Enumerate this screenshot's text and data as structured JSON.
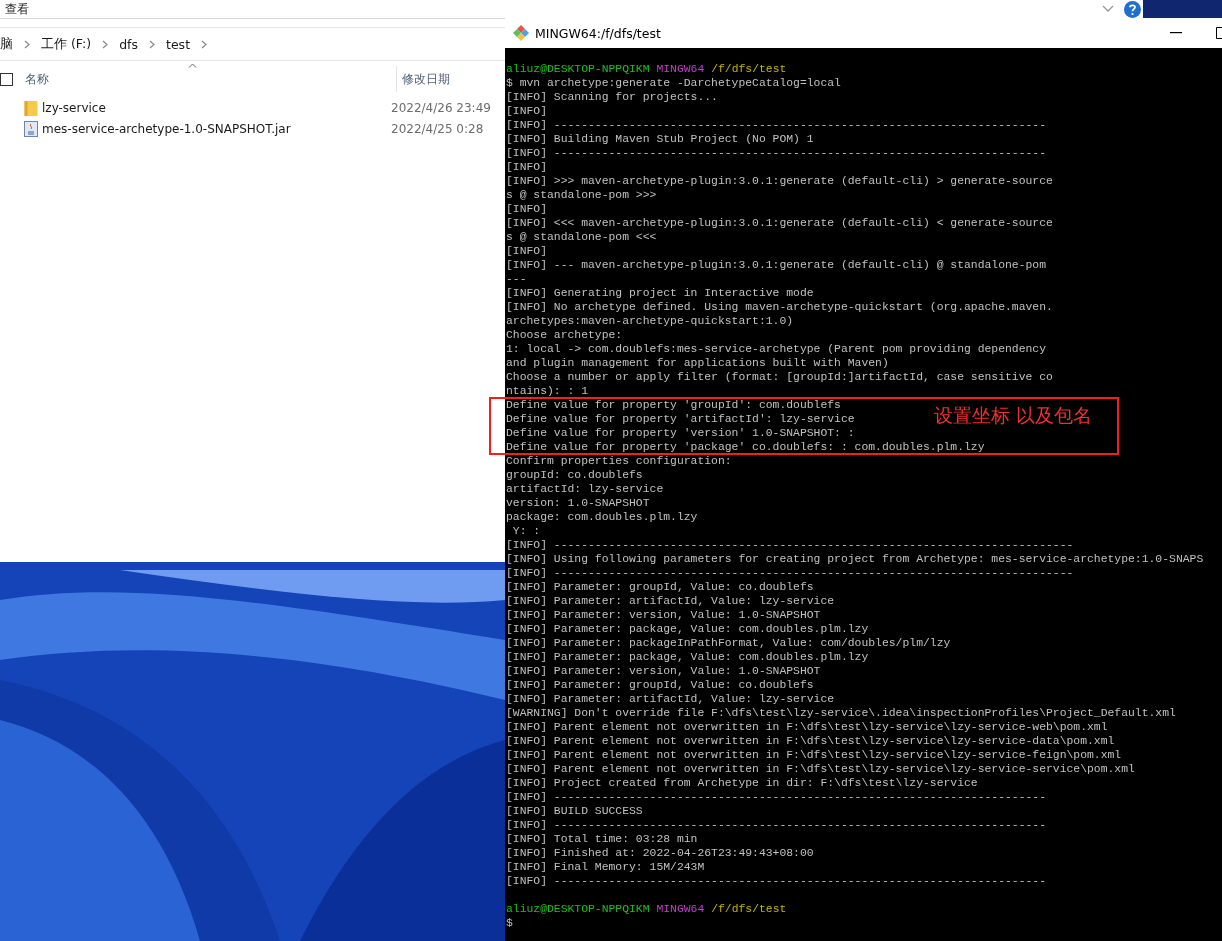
{
  "explorer": {
    "menu": "查看",
    "breadcrumb": [
      "脑",
      "工作 (F:)",
      "dfs",
      "test"
    ],
    "columns": [
      "名称",
      "修改日期"
    ],
    "select_all": {
      "checked": false
    },
    "files": [
      {
        "kind": "folder",
        "name": "lzy-service",
        "modified": "2022/4/26 23:49"
      },
      {
        "kind": "jar",
        "name": "mes-service-archetype-1.0-SNAPSHOT.jar",
        "modified": "2022/4/25 0:28"
      }
    ]
  },
  "terminal": {
    "title": "MINGW64:/f/dfs/test",
    "lines": [
      {
        "kind": "prompt",
        "user": "aliuz@DESKTOP-NPPQIKM",
        "shell": "MINGW64",
        "path": "/f/dfs/test"
      },
      {
        "kind": "text",
        "text": "$ mvn archetype:generate -DarchetypeCatalog=local"
      },
      {
        "kind": "text",
        "text": "[INFO] Scanning for projects..."
      },
      {
        "kind": "text",
        "text": "[INFO]"
      },
      {
        "kind": "text",
        "text": "[INFO] ------------------------------------------------------------------------"
      },
      {
        "kind": "text",
        "text": "[INFO] Building Maven Stub Project (No POM) 1"
      },
      {
        "kind": "text",
        "text": "[INFO] ------------------------------------------------------------------------"
      },
      {
        "kind": "text",
        "text": "[INFO]"
      },
      {
        "kind": "text",
        "text": "[INFO] >>> maven-archetype-plugin:3.0.1:generate (default-cli) > generate-source"
      },
      {
        "kind": "text",
        "text": "s @ standalone-pom >>>"
      },
      {
        "kind": "text",
        "text": "[INFO]"
      },
      {
        "kind": "text",
        "text": "[INFO] <<< maven-archetype-plugin:3.0.1:generate (default-cli) < generate-source"
      },
      {
        "kind": "text",
        "text": "s @ standalone-pom <<<"
      },
      {
        "kind": "text",
        "text": "[INFO]"
      },
      {
        "kind": "text",
        "text": "[INFO] --- maven-archetype-plugin:3.0.1:generate (default-cli) @ standalone-pom"
      },
      {
        "kind": "text",
        "text": "---"
      },
      {
        "kind": "text",
        "text": "[INFO] Generating project in Interactive mode"
      },
      {
        "kind": "text",
        "text": "[INFO] No archetype defined. Using maven-archetype-quickstart (org.apache.maven."
      },
      {
        "kind": "text",
        "text": "archetypes:maven-archetype-quickstart:1.0)"
      },
      {
        "kind": "text",
        "text": "Choose archetype:"
      },
      {
        "kind": "text",
        "text": "1: local -> com.doublefs:mes-service-archetype (Parent pom providing dependency"
      },
      {
        "kind": "text",
        "text": "and plugin management for applications built with Maven)"
      },
      {
        "kind": "text",
        "text": "Choose a number or apply filter (format: [groupId:]artifactId, case sensitive co"
      },
      {
        "kind": "text",
        "text": "ntains): : 1"
      },
      {
        "kind": "text",
        "text": "Define value for property 'groupId': com.doublefs"
      },
      {
        "kind": "text",
        "text": "Define value for property 'artifactId': lzy-service"
      },
      {
        "kind": "text",
        "text": "Define value for property 'version' 1.0-SNAPSHOT: :"
      },
      {
        "kind": "text",
        "text": "Define value for property 'package' co.doublefs: : com.doubles.plm.lzy"
      },
      {
        "kind": "text",
        "text": "Confirm properties configuration:"
      },
      {
        "kind": "text",
        "text": "groupId: co.doublefs"
      },
      {
        "kind": "text",
        "text": "artifactId: lzy-service"
      },
      {
        "kind": "text",
        "text": "version: 1.0-SNAPSHOT"
      },
      {
        "kind": "text",
        "text": "package: com.doubles.plm.lzy"
      },
      {
        "kind": "text",
        "text": " Y: :"
      },
      {
        "kind": "text",
        "text": "[INFO] ----------------------------------------------------------------------------"
      },
      {
        "kind": "text",
        "text": "[INFO] Using following parameters for creating project from Archetype: mes-service-archetype:1.0-SNAPS"
      },
      {
        "kind": "text",
        "text": "[INFO] ----------------------------------------------------------------------------"
      },
      {
        "kind": "text",
        "text": "[INFO] Parameter: groupId, Value: co.doublefs"
      },
      {
        "kind": "text",
        "text": "[INFO] Parameter: artifactId, Value: lzy-service"
      },
      {
        "kind": "text",
        "text": "[INFO] Parameter: version, Value: 1.0-SNAPSHOT"
      },
      {
        "kind": "text",
        "text": "[INFO] Parameter: package, Value: com.doubles.plm.lzy"
      },
      {
        "kind": "text",
        "text": "[INFO] Parameter: packageInPathFormat, Value: com/doubles/plm/lzy"
      },
      {
        "kind": "text",
        "text": "[INFO] Parameter: package, Value: com.doubles.plm.lzy"
      },
      {
        "kind": "text",
        "text": "[INFO] Parameter: version, Value: 1.0-SNAPSHOT"
      },
      {
        "kind": "text",
        "text": "[INFO] Parameter: groupId, Value: co.doublefs"
      },
      {
        "kind": "text",
        "text": "[INFO] Parameter: artifactId, Value: lzy-service"
      },
      {
        "kind": "text",
        "text": "[WARNING] Don't override file F:\\dfs\\test\\lzy-service\\.idea\\inspectionProfiles\\Project_Default.xml"
      },
      {
        "kind": "text",
        "text": "[INFO] Parent element not overwritten in F:\\dfs\\test\\lzy-service\\lzy-service-web\\pom.xml"
      },
      {
        "kind": "text",
        "text": "[INFO] Parent element not overwritten in F:\\dfs\\test\\lzy-service\\lzy-service-data\\pom.xml"
      },
      {
        "kind": "text",
        "text": "[INFO] Parent element not overwritten in F:\\dfs\\test\\lzy-service\\lzy-service-feign\\pom.xml"
      },
      {
        "kind": "text",
        "text": "[INFO] Parent element not overwritten in F:\\dfs\\test\\lzy-service\\lzy-service-service\\pom.xml"
      },
      {
        "kind": "text",
        "text": "[INFO] Project created from Archetype in dir: F:\\dfs\\test\\lzy-service"
      },
      {
        "kind": "text",
        "text": "[INFO] ------------------------------------------------------------------------"
      },
      {
        "kind": "text",
        "text": "[INFO] BUILD SUCCESS"
      },
      {
        "kind": "text",
        "text": "[INFO] ------------------------------------------------------------------------"
      },
      {
        "kind": "text",
        "text": "[INFO] Total time: 03:28 min"
      },
      {
        "kind": "text",
        "text": "[INFO] Finished at: 2022-04-26T23:49:43+08:00"
      },
      {
        "kind": "text",
        "text": "[INFO] Final Memory: 15M/243M"
      },
      {
        "kind": "text",
        "text": "[INFO] ------------------------------------------------------------------------"
      },
      {
        "kind": "blank"
      },
      {
        "kind": "prompt",
        "user": "aliuz@DESKTOP-NPPQIKM",
        "shell": "MINGW64",
        "path": "/f/dfs/test"
      },
      {
        "kind": "text",
        "text": "$"
      }
    ]
  },
  "annotation": {
    "text": "设置坐标 以及包名"
  }
}
